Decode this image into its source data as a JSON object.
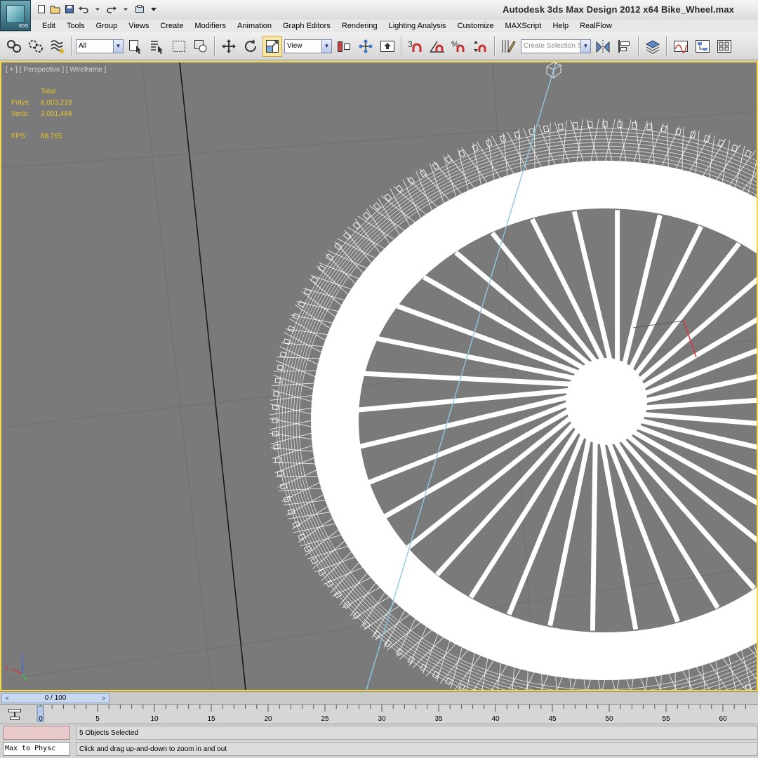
{
  "app": {
    "logo_text": "3DS",
    "window_title": "Autodesk 3ds Max Design 2012 x64      Bike_Wheel.max"
  },
  "quick_access": [
    "new-icon",
    "open-icon",
    "save-icon",
    "undo-icon",
    "redo-icon",
    "project-icon",
    "dropdown-icon"
  ],
  "menu": [
    "Edit",
    "Tools",
    "Group",
    "Views",
    "Create",
    "Modifiers",
    "Animation",
    "Graph Editors",
    "Rendering",
    "Lighting Analysis",
    "Customize",
    "MAXScript",
    "Help",
    "RealFlow"
  ],
  "toolbar": {
    "selection_filter": "All",
    "reference_coord": "View",
    "named_selection_placeholder": "Create Selection Se"
  },
  "viewport": {
    "label": "[ + ] [ Perspective ] [ Wireframe ]",
    "stats": {
      "header": "Total",
      "polys_label": "Polys:",
      "polys": "6,003,218",
      "verts_label": "Verts:",
      "verts": "3,001,484",
      "fps_label": "FPS:",
      "fps": "88.765"
    },
    "axis_labels": {
      "z": "z",
      "x": "x"
    },
    "wheel_spoke_count": 36,
    "colors": {
      "background": "#7a7a7a",
      "wireframe": "#ffffff",
      "border": "#f2d94b",
      "stats": "#e8c32a"
    }
  },
  "time_slider": {
    "value": "0 / 100",
    "left": "<",
    "right": ">"
  },
  "trackbar": {
    "ticks": [
      "0",
      "5",
      "10",
      "15",
      "20",
      "25",
      "30",
      "35",
      "40",
      "45",
      "50",
      "55",
      "60"
    ]
  },
  "status": {
    "maxscript": "Max to Physc",
    "selection": "5 Objects Selected",
    "prompt": "Click and drag up-and-down to zoom in and out"
  }
}
